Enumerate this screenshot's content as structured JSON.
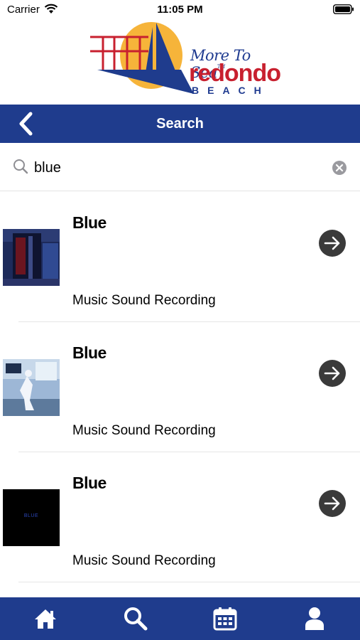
{
  "status_bar": {
    "carrier": "Carrier",
    "time": "11:05 PM"
  },
  "logo": {
    "tagline": "More To Sea",
    "tm": "TM",
    "city": "redondo",
    "beach": "BEACH"
  },
  "nav": {
    "title": "Search"
  },
  "search": {
    "value": "blue"
  },
  "results": [
    {
      "title": "Blue",
      "type": "Music Sound Recording"
    },
    {
      "title": "Blue",
      "type": "Music Sound Recording"
    },
    {
      "title": "Blue",
      "type": "Music Sound Recording"
    }
  ],
  "cover3_text": "BLUE",
  "tabs": [
    {
      "icon": "home-icon"
    },
    {
      "icon": "search-icon"
    },
    {
      "icon": "calendar-icon"
    },
    {
      "icon": "user-icon"
    }
  ],
  "colors": {
    "nav_blue": "#1f3c8d",
    "brand_red": "#c8202f",
    "sun_yellow": "#f6b43a"
  }
}
